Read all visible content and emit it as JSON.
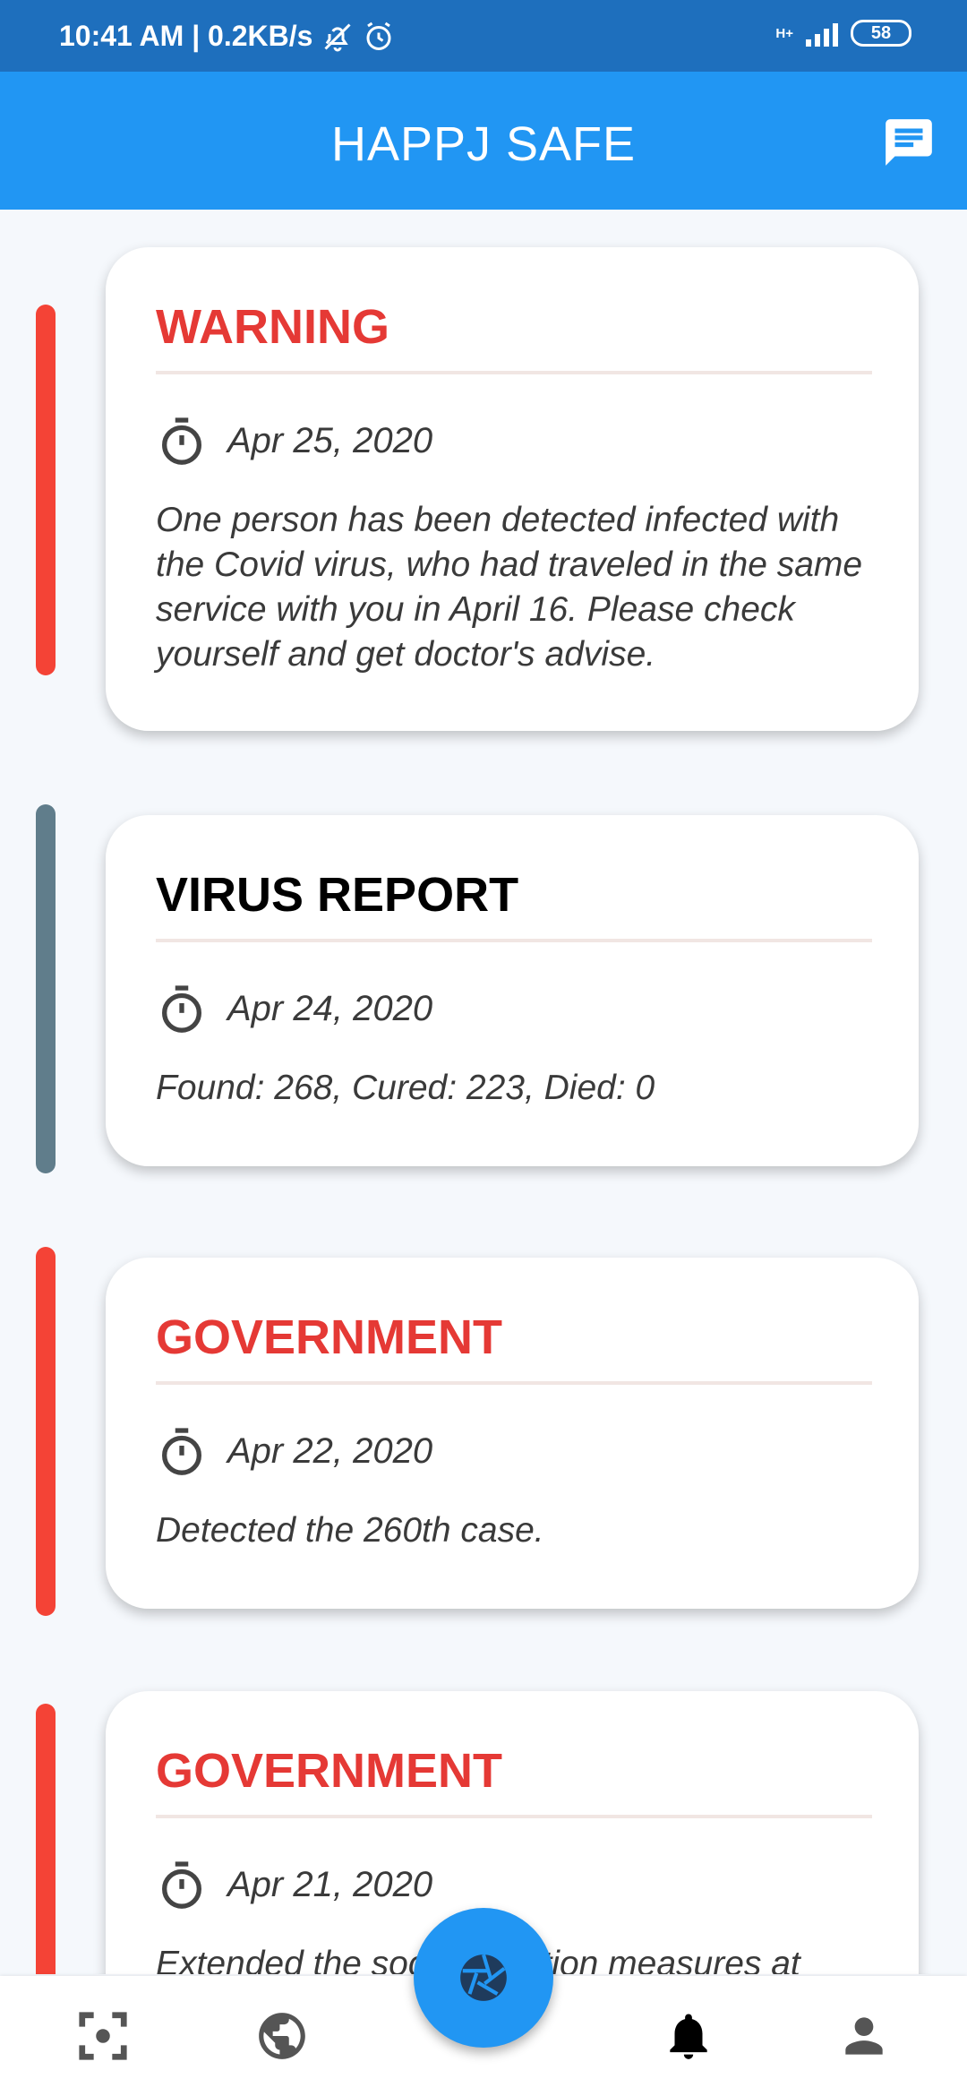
{
  "status_bar": {
    "time_info": "10:41 AM | 0.2KB/s",
    "network_type": "H+",
    "battery": "58"
  },
  "app_bar": {
    "title": "HAPPJ SAFE",
    "action_icon": "chat-icon"
  },
  "colors": {
    "primary": "#2196f3",
    "status_bar": "#1e6fbd",
    "alert_red": "#f44336",
    "report_gray": "#607d8b",
    "title_red": "#e53935"
  },
  "notifications": [
    {
      "category": "WARNING",
      "date": "Apr 25, 2020",
      "body": "One person has been detected infected with the Covid virus, who had traveled in the same service with you in April 16. Please check yourself and get doctor's advise.",
      "kind": "alert"
    },
    {
      "category": "VIRUS REPORT",
      "date": "Apr 24, 2020",
      "body": "Found: 268, Cured: 223, Died: 0",
      "kind": "report"
    },
    {
      "category": "GOVERNMENT",
      "date": "Apr 22, 2020",
      "body": "Detected the 260th case.",
      "kind": "alert"
    },
    {
      "category": "GOVERNMENT",
      "date": "Apr 21, 2020",
      "body": "Extended the social isolation measures at",
      "kind": "alert"
    }
  ],
  "bottom_nav": {
    "items": [
      "scan-icon",
      "globe-icon",
      "camera-aperture-icon",
      "bell-icon",
      "person-icon"
    ],
    "active": "bell-icon"
  }
}
